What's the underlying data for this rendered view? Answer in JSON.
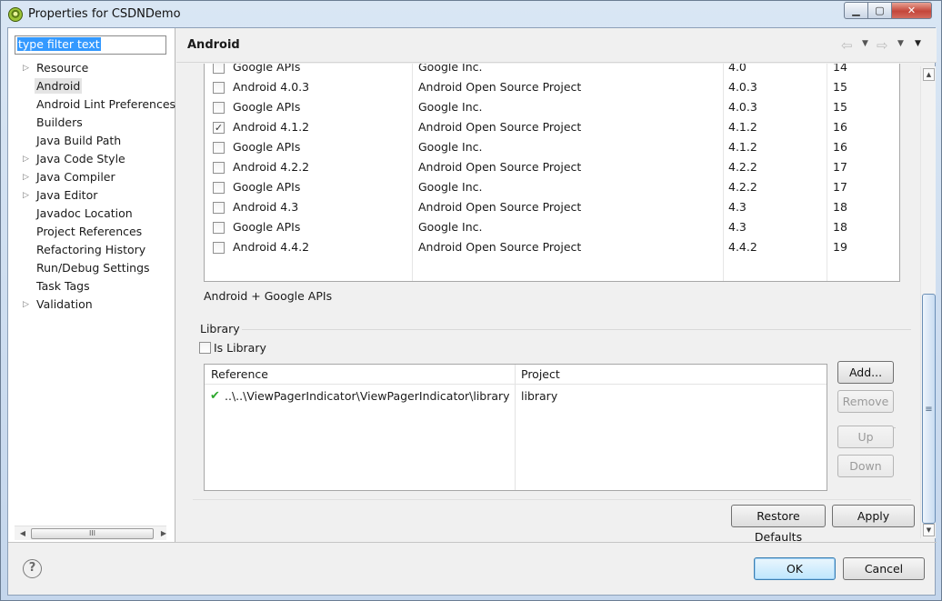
{
  "window": {
    "title": "Properties for CSDNDemo",
    "buttons": {
      "minimize": "▁",
      "maximize": "▢",
      "close": "✕"
    }
  },
  "filter": {
    "value": "type filter text"
  },
  "tree": {
    "items": [
      {
        "label": "Resource",
        "expandable": true
      },
      {
        "label": "Android",
        "expandable": false,
        "selected": true
      },
      {
        "label": "Android Lint Preferences",
        "expandable": false
      },
      {
        "label": "Builders",
        "expandable": false
      },
      {
        "label": "Java Build Path",
        "expandable": false
      },
      {
        "label": "Java Code Style",
        "expandable": true
      },
      {
        "label": "Java Compiler",
        "expandable": true
      },
      {
        "label": "Java Editor",
        "expandable": true
      },
      {
        "label": "Javadoc Location",
        "expandable": false
      },
      {
        "label": "Project References",
        "expandable": false
      },
      {
        "label": "Refactoring History",
        "expandable": false
      },
      {
        "label": "Run/Debug Settings",
        "expandable": false
      },
      {
        "label": "Task Tags",
        "expandable": false
      },
      {
        "label": "Validation",
        "expandable": true
      }
    ],
    "scroll_thumb": "III"
  },
  "page": {
    "title": "Android",
    "nav_back_icon": "arrow-left-icon",
    "nav_forward_icon": "arrow-right-icon"
  },
  "targets": [
    {
      "name": "Google APIs",
      "vendor": "Google Inc.",
      "platform": "4.0",
      "api": "14",
      "checked": false
    },
    {
      "name": "Android 4.0.3",
      "vendor": "Android Open Source Project",
      "platform": "4.0.3",
      "api": "15",
      "checked": false
    },
    {
      "name": "Google APIs",
      "vendor": "Google Inc.",
      "platform": "4.0.3",
      "api": "15",
      "checked": false
    },
    {
      "name": "Android 4.1.2",
      "vendor": "Android Open Source Project",
      "platform": "4.1.2",
      "api": "16",
      "checked": true
    },
    {
      "name": "Google APIs",
      "vendor": "Google Inc.",
      "platform": "4.1.2",
      "api": "16",
      "checked": false
    },
    {
      "name": "Android 4.2.2",
      "vendor": "Android Open Source Project",
      "platform": "4.2.2",
      "api": "17",
      "checked": false
    },
    {
      "name": "Google APIs",
      "vendor": "Google Inc.",
      "platform": "4.2.2",
      "api": "17",
      "checked": false
    },
    {
      "name": "Android 4.3",
      "vendor": "Android Open Source Project",
      "platform": "4.3",
      "api": "18",
      "checked": false
    },
    {
      "name": "Google APIs",
      "vendor": "Google Inc.",
      "platform": "4.3",
      "api": "18",
      "checked": false
    },
    {
      "name": "Android 4.4.2",
      "vendor": "Android Open Source Project",
      "platform": "4.4.2",
      "api": "19",
      "checked": false
    }
  ],
  "selected_target_label": "Android + Google APIs",
  "library": {
    "group_label": "Library",
    "is_library_label": "Is Library",
    "is_library_checked": false,
    "columns": {
      "reference": "Reference",
      "project": "Project"
    },
    "rows": [
      {
        "reference": "..\\..\\ViewPagerIndicator\\ViewPagerIndicator\\library",
        "project": "library",
        "status_icon": "check-icon"
      }
    ],
    "buttons": {
      "add": "Add...",
      "remove": "Remove",
      "up": "Up",
      "down": "Down"
    }
  },
  "page_buttons": {
    "restore_defaults": "Restore Defaults",
    "apply": "Apply"
  },
  "dialog_buttons": {
    "ok": "OK",
    "cancel": "Cancel",
    "help": "?"
  },
  "colors": {
    "selection": "#3399ff",
    "checkmark": "#2ea82e"
  }
}
